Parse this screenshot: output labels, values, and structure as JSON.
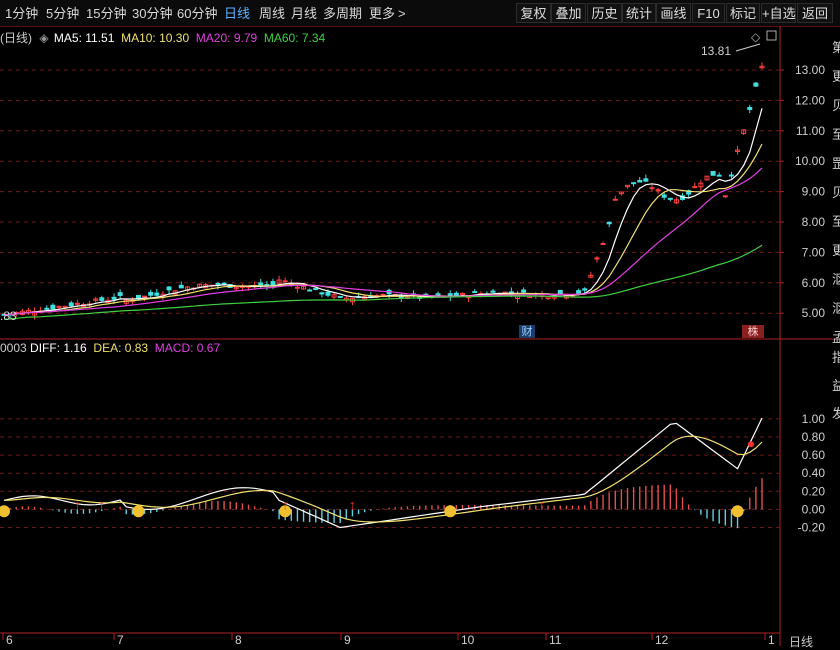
{
  "toolbar": {
    "timeframes": [
      {
        "label": "1分钟",
        "active": false
      },
      {
        "label": "5分钟",
        "active": false
      },
      {
        "label": "15分钟",
        "active": false
      },
      {
        "label": "30分钟",
        "active": false
      },
      {
        "label": "60分钟",
        "active": false
      },
      {
        "label": "日线",
        "active": true
      },
      {
        "label": "周线",
        "active": false
      },
      {
        "label": "月线",
        "active": false
      },
      {
        "label": "多周期",
        "active": false
      },
      {
        "label": "更多",
        "active": false
      }
    ],
    "more_arrow": ">",
    "tools": [
      "复权",
      "叠加",
      "历史",
      "统计",
      "画线",
      "F10",
      "标记",
      "+自选",
      "返回"
    ]
  },
  "main_chart": {
    "period_label": "(日线)",
    "ma": [
      {
        "label": "MA5: 11.51",
        "color": "#ffffff"
      },
      {
        "label": "MA10: 10.30",
        "color": "#f0e070"
      },
      {
        "label": "MA20: 9.79",
        "color": "#e040e0"
      },
      {
        "label": "MA60: 7.34",
        "color": "#40d040"
      }
    ],
    "y_ticks": [
      "13.00",
      "12.00",
      "11.00",
      "10.00",
      "9.00",
      "8.00",
      "7.00",
      "6.00",
      "5.00"
    ],
    "high_label": "13.81",
    "low_label": ".83",
    "badges": [
      {
        "text": "财"
      },
      {
        "text": "株"
      }
    ],
    "right_edge_chars": [
      "第",
      "更",
      "贝",
      "至",
      "罡",
      "贝",
      "至",
      "更",
      "沤",
      "沤",
      "孟"
    ]
  },
  "macd_chart": {
    "code_fragment": "0003",
    "diff_label": "DIFF: 1.16",
    "dea_label": "DEA: 0.83",
    "macd_label": "MACD: 0.67",
    "y_ticks": [
      "1.00",
      "0.80",
      "0.60",
      "0.40",
      "0.20",
      "0.00",
      "-0.20"
    ],
    "right_edge_chars": [
      "指",
      "益",
      "发"
    ],
    "colors": {
      "diff": "#ffffff",
      "dea": "#f0e070",
      "macd": "#e040e0",
      "up_bar": "#e05050",
      "down_bar": "#60d0e0"
    }
  },
  "time_axis": {
    "labels": [
      "6",
      "7",
      "8",
      "9",
      "10",
      "11",
      "12",
      "1"
    ],
    "period_label": "日线"
  },
  "chart_data": [
    {
      "type": "candlestick",
      "title": "",
      "ylim": [
        4.6,
        14.4
      ],
      "ma_latest": {
        "MA5": 11.51,
        "MA10": 10.3,
        "MA20": 9.79,
        "MA60": 7.34
      },
      "note_high": 13.81
    },
    {
      "type": "line",
      "title": "",
      "ylim": [
        -0.26,
        1.25
      ],
      "latest": {
        "DIFF": 1.16,
        "DEA": 0.83,
        "MACD": 0.67
      }
    }
  ]
}
